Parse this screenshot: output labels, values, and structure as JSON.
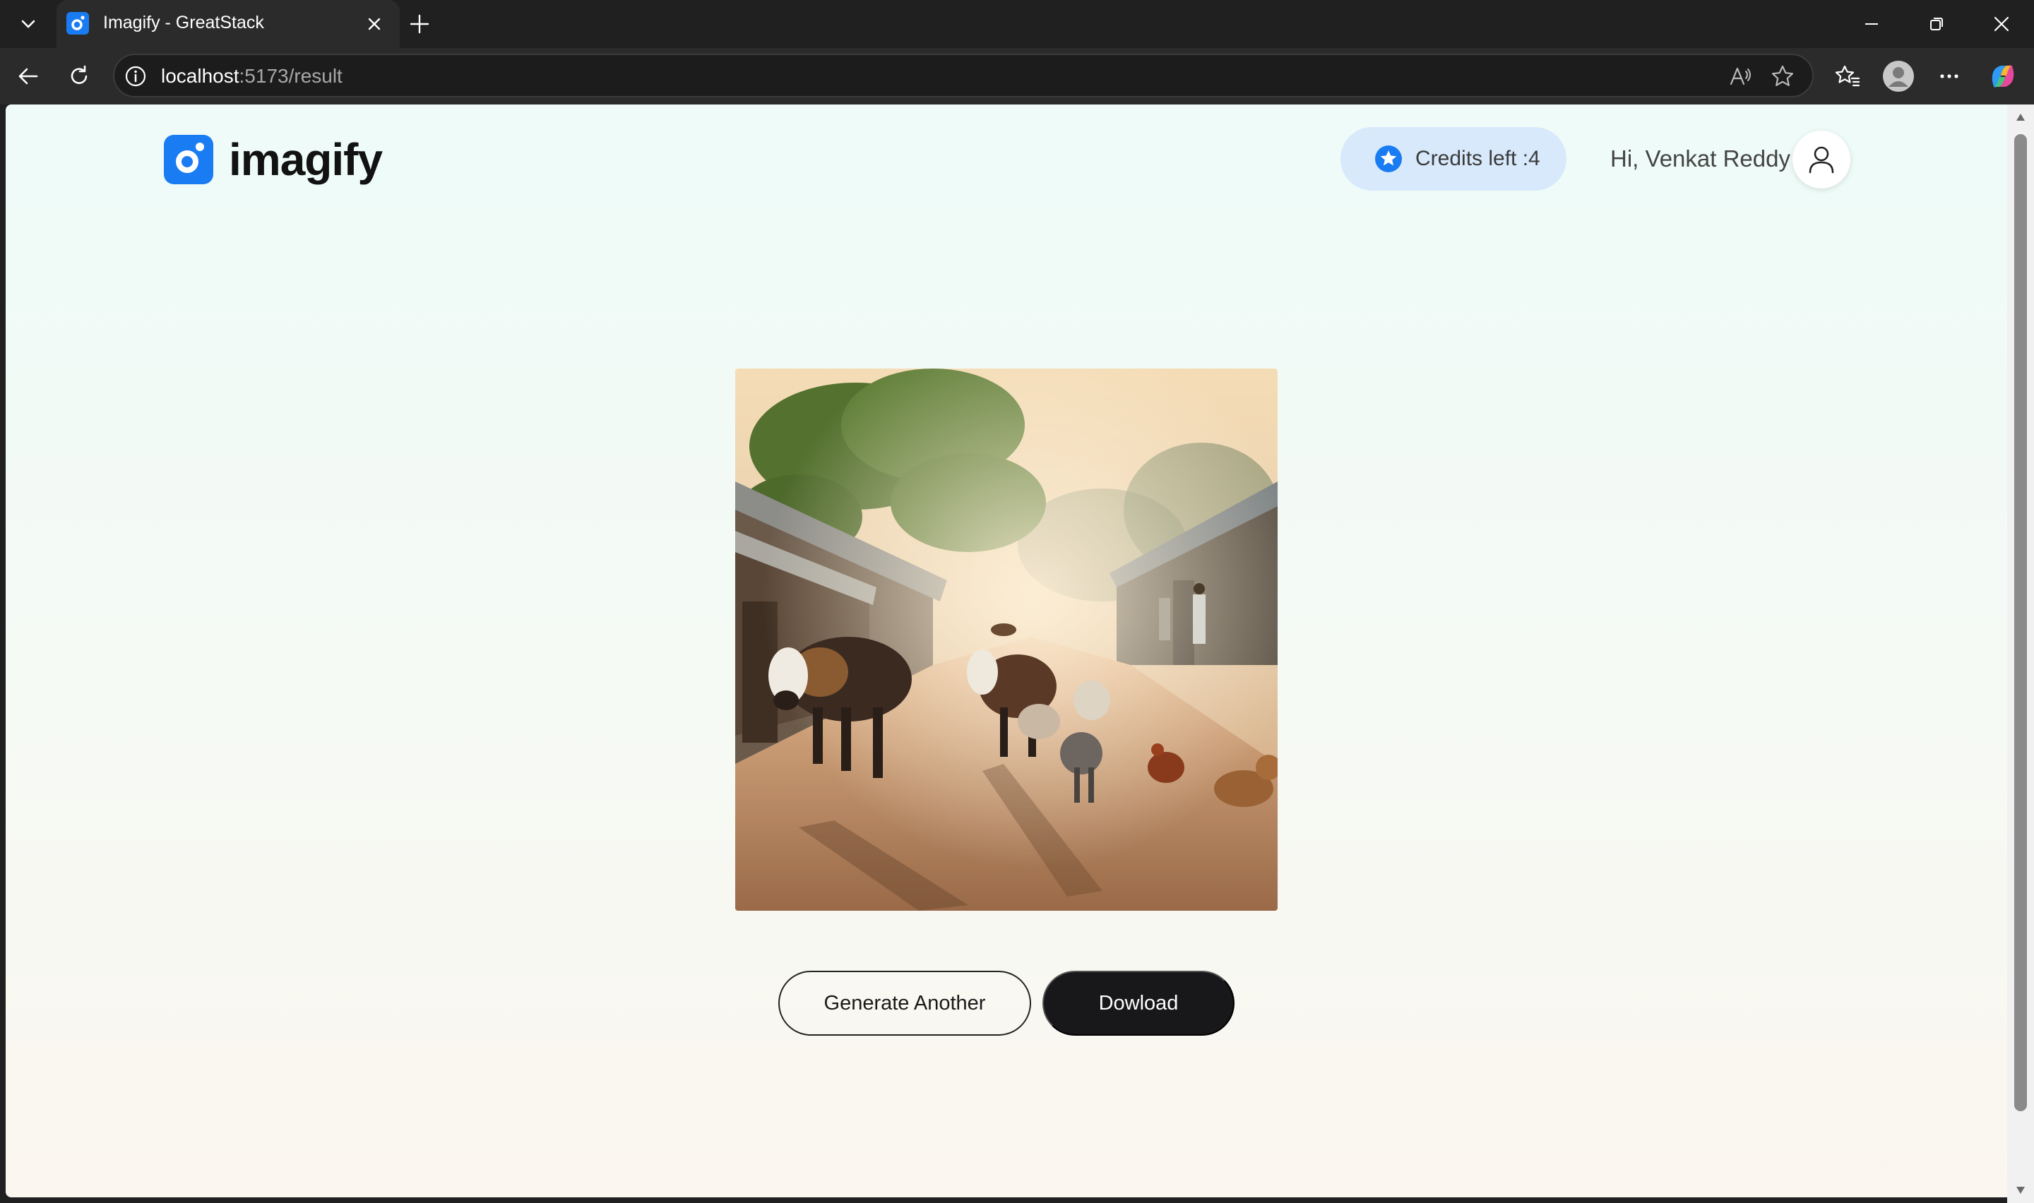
{
  "browser": {
    "tab_title": "Imagify - GreatStack",
    "url_host": "localhost",
    "url_path": ":5173/result",
    "icons": [
      "tab-list-icon",
      "favicon-icon",
      "close-icon",
      "new-tab-icon",
      "minimize-icon",
      "restore-icon",
      "window-close-icon",
      "back-icon",
      "refresh-icon",
      "info-icon",
      "read-aloud-icon",
      "favorite-star-icon",
      "favorites-icon",
      "profile-icon",
      "more-icon",
      "copilot-icon"
    ]
  },
  "header": {
    "logo_text": "imagify",
    "credits_label": "Credits left :4",
    "greeting": "Hi, Venkat Reddy",
    "icons": [
      "logo-icon",
      "star-icon",
      "user-icon"
    ]
  },
  "result": {
    "image_description": "Village road with cows, goats and chickens at sunrise"
  },
  "actions": {
    "generate_another_label": "Generate Another",
    "download_label": "Dowload"
  },
  "colors": {
    "accent": "#1a7cf2",
    "credits_bg": "#d7e9fb",
    "dark_button": "#18181a"
  }
}
